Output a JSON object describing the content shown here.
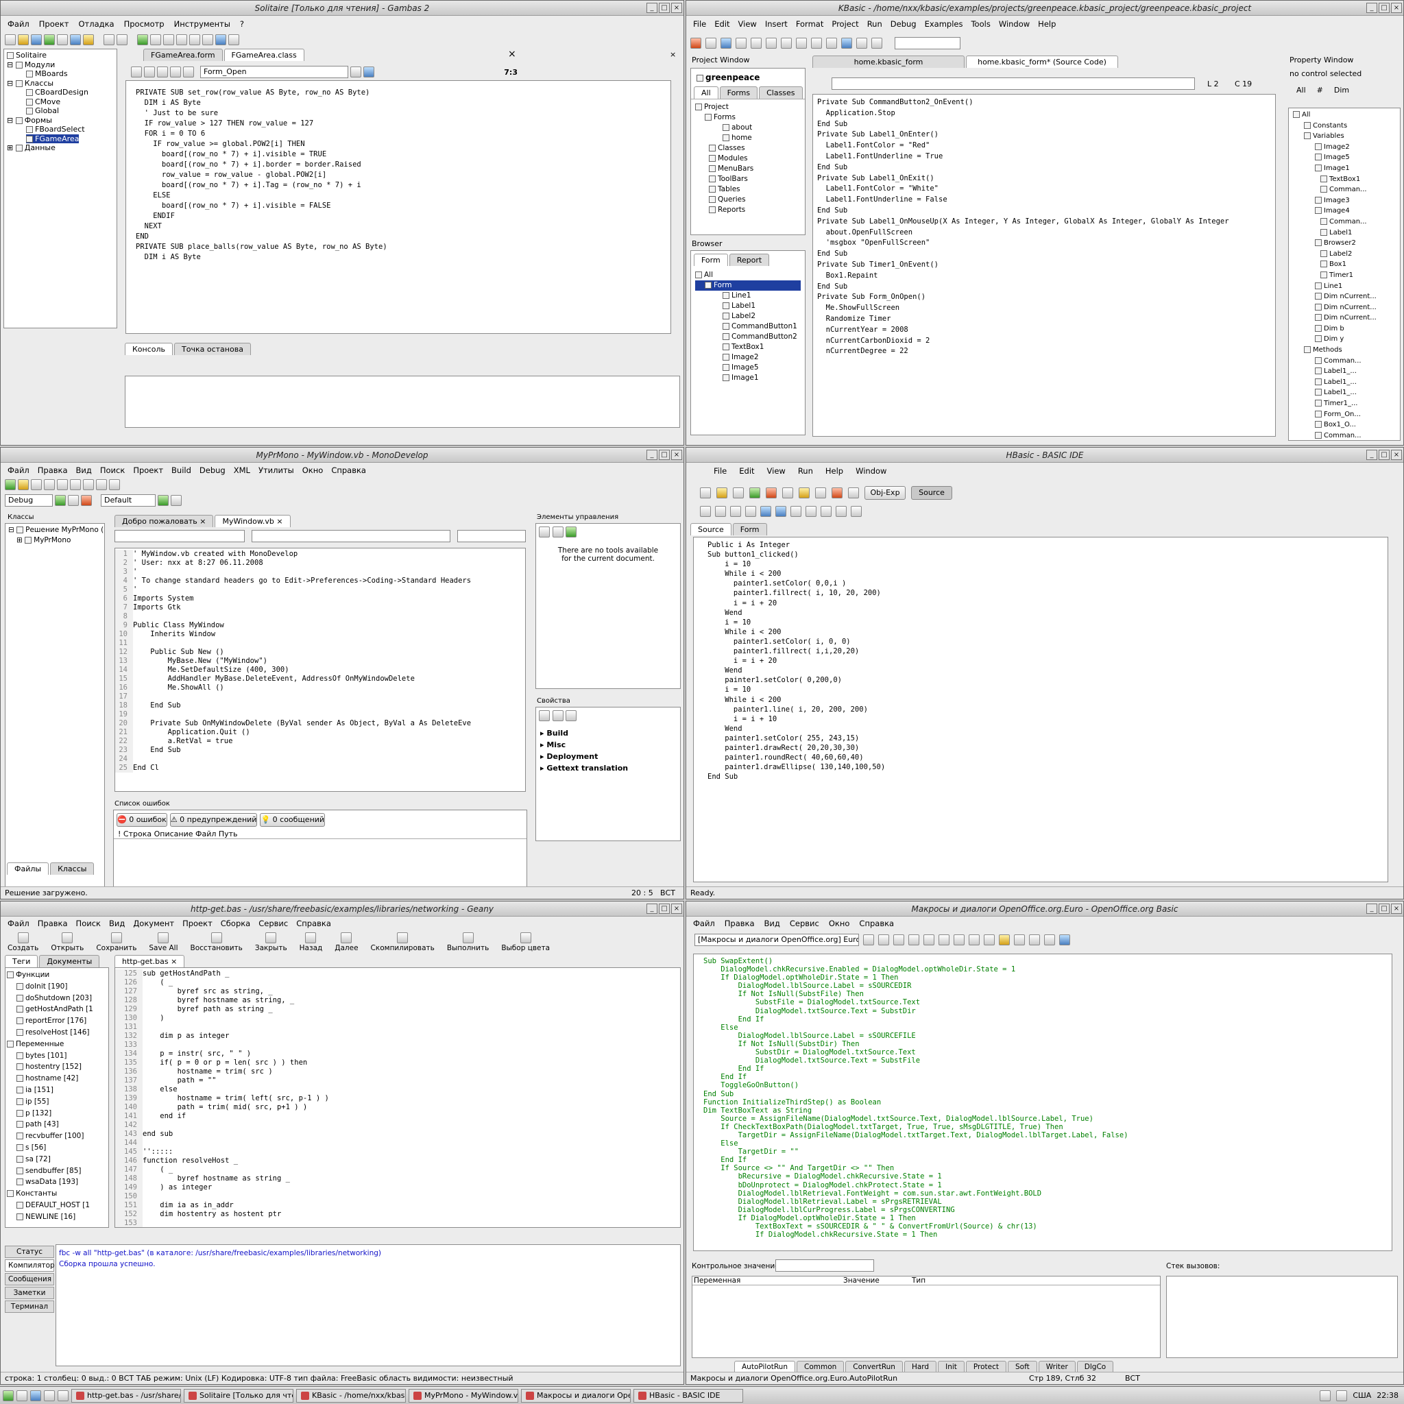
{
  "gambas": {
    "title": "Solitaire [Только для чтения] - Gambas 2",
    "menu": [
      "Файл",
      "Проект",
      "Отладка",
      "Просмотр",
      "Инструменты",
      "?"
    ],
    "tree": [
      "Solitaire",
      "Модули",
      "MBoards",
      "Классы",
      "CBoardDesign",
      "CMove",
      "Global",
      "Формы",
      "FBoardSelect",
      "FGameArea",
      "Данные"
    ],
    "tabs": [
      "FGameArea.form",
      "FGameArea.class"
    ],
    "proc_combo": "Form_Open",
    "pos": "7:3",
    "code": [
      "PRIVATE SUB set_row(row_value AS Byte, row_no AS Byte)",
      "",
      "  DIM i AS Byte",
      "",
      "  ' Just to be sure",
      "  IF row_value > 127 THEN row_value = 127",
      "",
      "  FOR i = 0 TO 6",
      "    IF row_value >= global.POW2[i] THEN",
      "      board[(row_no * 7) + i].visible = TRUE",
      "      board[(row_no * 7) + i].border = border.Raised",
      "      row_value = row_value - global.POW2[i]",
      "      board[(row_no * 7) + i].Tag = (row_no * 7) + i",
      "    ELSE",
      "      board[(row_no * 7) + i].visible = FALSE",
      "    ENDIF",
      "  NEXT",
      "",
      "END",
      "",
      "PRIVATE SUB place_balls(row_value AS Byte, row_no AS Byte)",
      "",
      "  DIM i AS Byte"
    ],
    "bottom_tabs": [
      "Консоль",
      "Точка останова"
    ]
  },
  "kbasic": {
    "title": "KBasic - /home/nxx/kbasic/examples/projects/greenpeace.kbasic_project/greenpeace.kbasic_project",
    "menu": [
      "File",
      "Edit",
      "View",
      "Insert",
      "Format",
      "Project",
      "Run",
      "Debug",
      "Examples",
      "Tools",
      "Window",
      "Help"
    ],
    "project_window": "Project Window",
    "project_name": "greenpeace",
    "proj_tabs": [
      "All",
      "Forms",
      "Classes"
    ],
    "proj_tree": [
      "Project",
      "Forms",
      "about",
      "home",
      "Classes",
      "Modules",
      "MenuBars",
      "ToolBars",
      "Tables",
      "Queries",
      "Reports"
    ],
    "browser": "Browser",
    "browser_tabs": [
      "Form",
      "Report"
    ],
    "browser_tree": [
      "All",
      "Form",
      "Line1",
      "Label1",
      "Label2",
      "CommandButton1",
      "CommandButton2",
      "TextBox1",
      "Image2",
      "Image5",
      "Image1"
    ],
    "tabs": [
      "home.kbasic_form",
      "home.kbasic_form* (Source Code)"
    ],
    "line": "L 2",
    "col": "C 19",
    "code": [
      "Private Sub CommandButton2_OnEvent()",
      "  Application.Stop",
      "End Sub",
      "",
      "Private Sub Label1_OnEnter()",
      "  Label1.FontColor = \"Red\"",
      "  Label1.FontUnderline = True",
      "End Sub",
      "",
      "Private Sub Label1_OnExit()",
      "  Label1.FontColor = \"White\"",
      "  Label1.FontUnderline = False",
      "End Sub",
      "",
      "Private Sub Label1_OnMouseUp(X As Integer, Y As Integer, GlobalX As Integer, GlobalY As Integer",
      "  about.OpenFullScreen",
      "  'msgbox \"OpenFullScreen\"",
      "End Sub",
      "",
      "Private Sub Timer1_OnEvent()",
      "  Box1.Repaint",
      "End Sub",
      "",
      "Private Sub Form_OnOpen()",
      "  Me.ShowFullScreen",
      "",
      "  Randomize Timer",
      "",
      "  nCurrentYear = 2008",
      "  nCurrentCarbonDioxid = 2",
      "  nCurrentDegree = 22"
    ],
    "property_window": "Property Window",
    "no_control": "no control selected",
    "prop_tabs": [
      "All",
      "#",
      "Dim"
    ],
    "prop_tree": [
      "All",
      "Constants",
      "Variables",
      "Image2",
      "Image5",
      "Image1",
      "TextBox1",
      "Comman...",
      "Image3",
      "Image4",
      "Comman...",
      "Label1",
      "Browser2",
      "Label2",
      "Box1",
      "Timer1",
      "Line1",
      "Dim nCurrent...",
      "Dim nCurrent...",
      "Dim nCurrent...",
      "Dim b",
      "Dim y",
      "Methods",
      "Comman...",
      "Label1_...",
      "Label1_...",
      "Label1_...",
      "Timer1_...",
      "Form_On...",
      "Box1_O...",
      "Comman..."
    ]
  },
  "mono": {
    "title": "MyPrMono - MyWindow.vb - MonoDevelop",
    "menu": [
      "Файл",
      "Правка",
      "Вид",
      "Поиск",
      "Проект",
      "Build",
      "Debug",
      "XML",
      "Утилиты",
      "Окно",
      "Справка"
    ],
    "config": "Debug",
    "platform": "Default",
    "classes_title": "Классы",
    "tree": [
      "Решение MyPrMono (1",
      "MyPrMono"
    ],
    "tabs": [
      "Добро пожаловать",
      "MyWindow.vb"
    ],
    "code": [
      "' MyWindow.vb created with MonoDevelop",
      "' User: nxx at 8:27 06.11.2008",
      "'",
      "' To change standard headers go to Edit->Preferences->Coding->Standard Headers",
      "'",
      "Imports System",
      "Imports Gtk",
      "",
      "Public Class MyWindow",
      "    Inherits Window",
      "",
      "    Public Sub New ()",
      "        MyBase.New (\"MyWindow\")",
      "        Me.SetDefaultSize (400, 300)",
      "        AddHandler MyBase.DeleteEvent, AddressOf OnMyWindowDelete",
      "        Me.ShowAll ()",
      "",
      "    End Sub",
      "",
      "    Private Sub OnMyWindowDelete (ByVal sender As Object, ByVal a As DeleteEve",
      "        Application.Quit ()",
      "        a.RetVal = true",
      "    End Sub",
      "",
      "End Cl"
    ],
    "toolbox_title": "Элементы управления",
    "no_tools": "There are no tools available for the current document.",
    "props_title": "Свойства",
    "props": [
      "Build",
      "Misc",
      "Deployment",
      "Gettext translation"
    ],
    "errors_title": "Список ошибок",
    "errors": "0 ошибок",
    "warnings": "0 предупреждений",
    "messages": "0 сообщений",
    "err_cols": "!   Строка  Описание  Файл  Путь",
    "bottom_tabs": [
      "Файлы",
      "Классы"
    ],
    "status": "Решение загружено.",
    "cursor": "20 : 5",
    "mode": "ВСТ"
  },
  "hbasic": {
    "title": "HBasic - BASIC IDE",
    "menu": [
      "File",
      "Edit",
      "View",
      "Run",
      "Help",
      "Window"
    ],
    "objexp": "Obj-Exp",
    "source_btn": "Source",
    "tabs": [
      "Source",
      "Form"
    ],
    "code": [
      "Public i As Integer",
      "",
      "Sub button1_clicked()",
      "",
      "    i = 10",
      "    While i < 200",
      "      painter1.setColor( 0,0,i )",
      "      painter1.fillrect( i, 10, 20, 200)",
      "",
      "      i = i + 20",
      "    Wend",
      "",
      "    i = 10",
      "    While i < 200",
      "      painter1.setColor( i, 0, 0)",
      "      painter1.fillrect( i,i,20,20)",
      "",
      "      i = i + 20",
      "    Wend",
      "",
      "    painter1.setColor( 0,200,0)",
      "    i = 10",
      "    While i < 200",
      "      painter1.line( i, 20, 200, 200)",
      "      i = i + 10",
      "    Wend",
      "",
      "    painter1.setColor( 255, 243,15)",
      "    painter1.drawRect( 20,20,30,30)",
      "    painter1.roundRect( 40,60,60,40)",
      "    painter1.drawEllipse( 130,140,100,50)",
      "End Sub"
    ],
    "status": "Ready."
  },
  "geany": {
    "title": "http-get.bas - /usr/share/freebasic/examples/libraries/networking - Geany",
    "menu": [
      "Файл",
      "Правка",
      "Поиск",
      "Вид",
      "Документ",
      "Проект",
      "Сборка",
      "Сервис",
      "Справка"
    ],
    "toolbar": [
      "Создать",
      "Открыть",
      "Сохранить",
      "Save All",
      "Восстановить",
      "Закрыть",
      "Назад",
      "Далее",
      "Скомпилировать",
      "Выполнить",
      "Выбор цвета"
    ],
    "side_tabs": [
      "Теги",
      "Документы"
    ],
    "file_tab": "http-get.bas",
    "symbols": [
      "Функции",
      "doInit [190]",
      "doShutdown [203]",
      "getHostAndPath [1",
      "reportError [176]",
      "resolveHost [146]",
      "Переменные",
      "bytes [101]",
      "hostentry [152]",
      "hostname [42]",
      "ia [151]",
      "ip [55]",
      "p [132]",
      "path [43]",
      "recvbuffer [100]",
      "s [56]",
      "sa [72]",
      "sendbuffer [85]",
      "wsaData [193]",
      "Константы",
      "DEFAULT_HOST [1",
      "NEWLINE [16]"
    ],
    "line_start": 125,
    "code": [
      "sub getHostAndPath _",
      "    ( _",
      "        byref src as string, _",
      "        byref hostname as string, _",
      "        byref path as string _",
      "    )",
      "",
      "    dim p as integer",
      "",
      "    p = instr( src, \" \" )",
      "    if( p = 0 or p = len( src ) ) then",
      "        hostname = trim( src )",
      "        path = \"\"",
      "    else",
      "        hostname = trim( left( src, p-1 ) )",
      "        path = trim( mid( src, p+1 ) )",
      "    end if",
      "",
      "end sub",
      "",
      "'':::::",
      "function resolveHost _",
      "    ( _",
      "        byref hostname as string _",
      "    ) as integer",
      "",
      "    dim ia as in_addr",
      "    dim hostentry as hostent ptr",
      ""
    ],
    "msg_tabs": [
      "Статус",
      "Компилятор",
      "Сообщения",
      "Заметки",
      "Терминал"
    ],
    "msg1": "fbc -w all \"http-get.bas\" (в каталоге: /usr/share/freebasic/examples/libraries/networking)",
    "msg2": "Сборка прошла успешно.",
    "status": "строка: 1      столбец: 0     выд.: 0   ВСТ    ТАБ     режим: Unix (LF)     Кодировка: UTF-8     тип файла: FreeBasic     область видимости: неизвестный"
  },
  "ooo": {
    "title": "Макросы и диалоги OpenOffice.org.Euro - OpenOffice.org Basic",
    "menu": [
      "Файл",
      "Правка",
      "Вид",
      "Сервис",
      "Окно",
      "Справка"
    ],
    "library": "[Макросы и диалоги OpenOffice.org] Euro",
    "code": [
      "Sub SwapExtent()",
      "    DialogModel.chkRecursive.Enabled = DialogModel.optWholeDir.State = 1",
      "    If DialogModel.optWholeDir.State = 1 Then",
      "        DialogModel.lblSource.Label = sSOURCEDIR",
      "        If Not IsNull(SubstFile) Then",
      "            SubstFile = DialogModel.txtSource.Text",
      "            DialogModel.txtSource.Text = SubstDir",
      "        End If",
      "    Else",
      "        DialogModel.lblSource.Label = sSOURCEFILE",
      "        If Not IsNull(SubstDir) Then",
      "            SubstDir = DialogModel.txtSource.Text",
      "            DialogModel.txtSource.Text = SubstFile",
      "        End If",
      "    End If",
      "    ToggleGoOnButton()",
      "End Sub",
      "",
      "",
      "Function InitializeThirdStep() as Boolean",
      "Dim TextBoxText as String",
      "    Source = AssignFileName(DialogModel.txtSource.Text, DialogModel.lblSource.Label, True)",
      "    If CheckTextBoxPath(DialogModel.txtTarget, True, True, sMsgDLGTITLE, True) Then",
      "        TargetDir = AssignFileName(DialogModel.txtTarget.Text, DialogModel.lblTarget.Label, False)",
      "    Else",
      "        TargetDir = \"\"",
      "    End If",
      "    If Source <> \"\" And TargetDir <> \"\" Then",
      "        bRecursive = DialogModel.chkRecursive.State = 1",
      "        bDoUnprotect = DialogModel.chkProtect.State = 1",
      "        DialogModel.lblRetrieval.FontWeight = com.sun.star.awt.FontWeight.BOLD",
      "        DialogModel.lblRetrieval.Label = sPrgsRETRIEVAL",
      "        DialogModel.lblCurProgress.Label = sPrgsCONVERTING",
      "        If DialogModel.optWholeDir.State = 1 Then",
      "            TextBoxText = sSOURCEDIR & \" \" & ConvertFromUrl(Source) & chr(13)",
      "            If DialogModel.chkRecursive.State = 1 Then"
    ],
    "watch_label": "Контрольное значение:",
    "callstack": "Стек вызовов:",
    "watch_cols": [
      "Переменная",
      "Значение",
      "Тип"
    ],
    "sheet_tabs": [
      "AutoPilotRun",
      "Common",
      "ConvertRun",
      "Hard",
      "Init",
      "Protect",
      "Soft",
      "Writer",
      "DlgCo"
    ],
    "status_left": "Макросы и диалоги OpenOffice.org.Euro.AutoPilotRun",
    "status_pos": "Стр 189, Стлб 32",
    "status_mode": "ВСТ"
  },
  "taskbar": {
    "tasks": [
      "http-get.bas - /usr/share/f...",
      "Solitaire [Только для чтен...",
      "KBasic - /home/nxx/kbasi...",
      "MyPrMono - MyWindow.v...",
      "Макросы и диалоги Open...",
      "HBasic - BASIC IDE"
    ],
    "locale": "США",
    "clock": "22:38"
  }
}
